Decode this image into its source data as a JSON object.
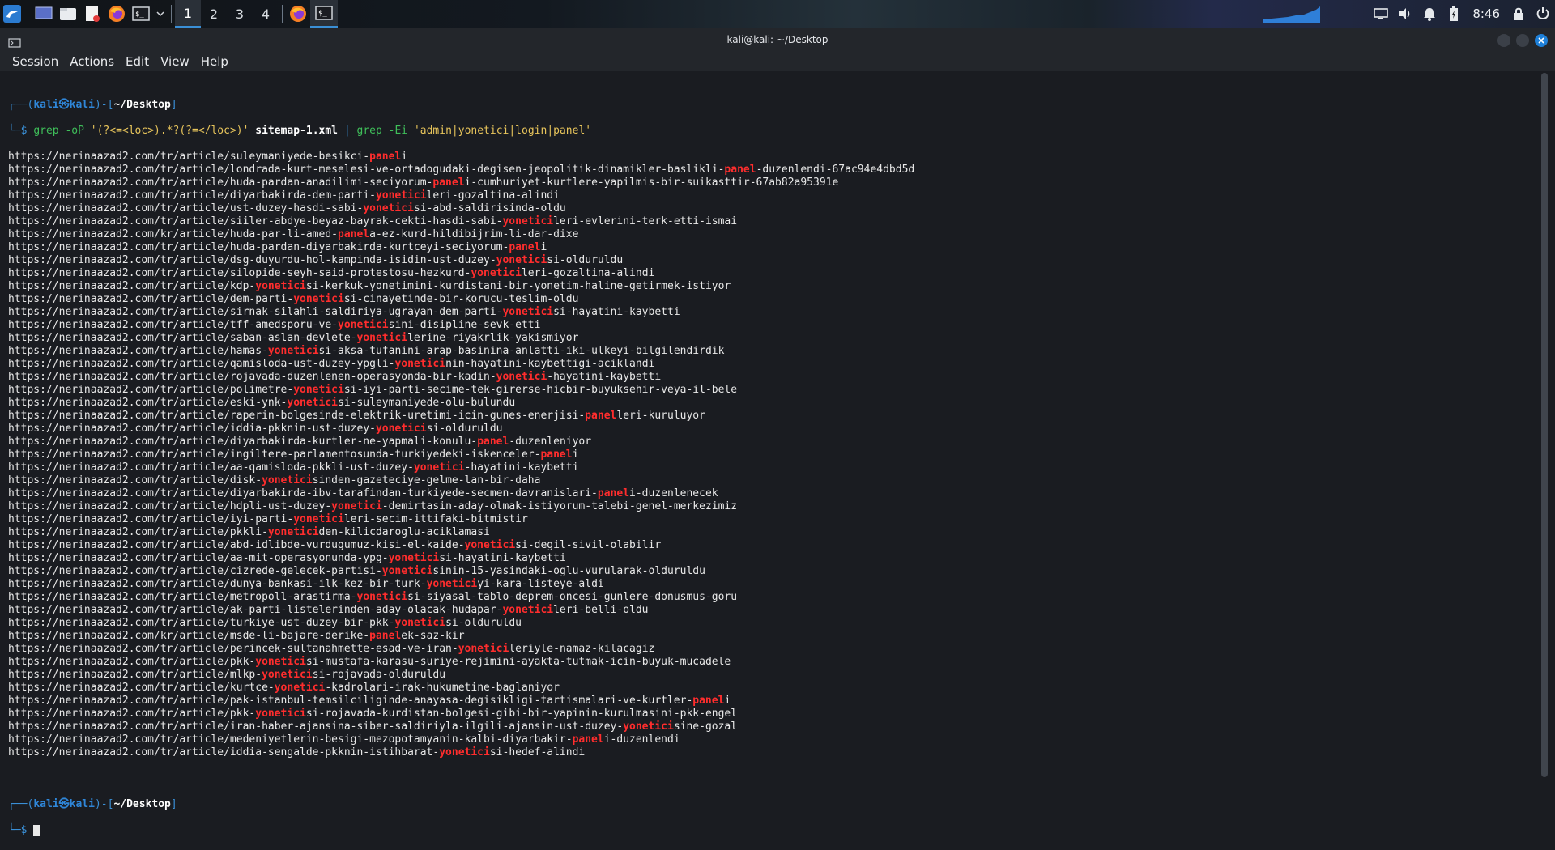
{
  "taskbar": {
    "workspaces": [
      "1",
      "2",
      "3",
      "4"
    ],
    "active_workspace": "1",
    "clock": "8:46",
    "icons": [
      "kali-menu-icon",
      "desktop-icon",
      "files-icon",
      "text-editor-icon",
      "firefox-icon",
      "terminal-icon",
      "chevron-down-icon"
    ]
  },
  "window": {
    "title": "kali@kali: ~/Desktop"
  },
  "menu": {
    "items": [
      "Session",
      "Actions",
      "Edit",
      "View",
      "Help"
    ]
  },
  "terminal": {
    "prompt_user": "kali",
    "prompt_host": "kali",
    "prompt_dir": "~/Desktop",
    "command": {
      "grep1": "grep",
      "flags1": " -oP ",
      "pattern1": "'(?<=<loc>).*?(?=</loc>)'",
      "file": " sitemap-1.xml ",
      "pipe": "|",
      "grep2": " grep",
      "flags2": " -Ei ",
      "pattern2": "'admin|yonetici|login|panel'"
    },
    "output": [
      [
        "https://nerinaazad2.com/tr/article/suleymaniyede-besikci-",
        "panel",
        "i"
      ],
      [
        "https://nerinaazad2.com/tr/article/londrada-kurt-meselesi-ve-ortadogudaki-degisen-jeopolitik-dinamikler-baslikli-",
        "panel",
        "-duzenlendi-67ac94e4dbd5d"
      ],
      [
        "https://nerinaazad2.com/tr/article/huda-pardan-anadilimi-seciyorum-",
        "panel",
        "i-cumhuriyet-kurtlere-yapilmis-bir-suikasttir-67ab82a95391e"
      ],
      [
        "https://nerinaazad2.com/tr/article/diyarbakirda-dem-parti-",
        "yonetici",
        "leri-gozaltina-alindi"
      ],
      [
        "https://nerinaazad2.com/tr/article/ust-duzey-hasdi-sabi-",
        "yonetici",
        "si-abd-saldirisinda-oldu"
      ],
      [
        "https://nerinaazad2.com/tr/article/siiler-abdye-beyaz-bayrak-cekti-hasdi-sabi-",
        "yonetici",
        "leri-evlerini-terk-etti-ismai"
      ],
      [
        "https://nerinaazad2.com/kr/article/huda-par-li-amed-",
        "panel",
        "a-ez-kurd-hildibijrim-li-dar-dixe"
      ],
      [
        "https://nerinaazad2.com/tr/article/huda-pardan-diyarbakirda-kurtceyi-seciyorum-",
        "panel",
        "i"
      ],
      [
        "https://nerinaazad2.com/tr/article/dsg-duyurdu-hol-kampinda-isidin-ust-duzey-",
        "yonetici",
        "si-olduruldu"
      ],
      [
        "https://nerinaazad2.com/tr/article/silopide-seyh-said-protestosu-hezkurd-",
        "yonetici",
        "leri-gozaltina-alindi"
      ],
      [
        "https://nerinaazad2.com/tr/article/kdp-",
        "yonetici",
        "si-kerkuk-yonetimini-kurdistani-bir-yonetim-haline-getirmek-istiyor"
      ],
      [
        "https://nerinaazad2.com/tr/article/dem-parti-",
        "yonetici",
        "si-cinayetinde-bir-korucu-teslim-oldu"
      ],
      [
        "https://nerinaazad2.com/tr/article/sirnak-silahli-saldiriya-ugrayan-dem-parti-",
        "yonetici",
        "si-hayatini-kaybetti"
      ],
      [
        "https://nerinaazad2.com/tr/article/tff-amedsporu-ve-",
        "yonetici",
        "sini-disipline-sevk-etti"
      ],
      [
        "https://nerinaazad2.com/tr/article/saban-aslan-devlete-",
        "yonetici",
        "lerine-riyakrlik-yakismiyor"
      ],
      [
        "https://nerinaazad2.com/tr/article/hamas-",
        "yonetici",
        "si-aksa-tufanini-arap-basinina-anlatti-iki-ulkeyi-bilgilendirdik"
      ],
      [
        "https://nerinaazad2.com/tr/article/qamisloda-ust-duzey-ypgli-",
        "yonetici",
        "nin-hayatini-kaybettigi-aciklandi"
      ],
      [
        "https://nerinaazad2.com/tr/article/rojavada-duzenlenen-operasyonda-bir-kadin-",
        "yonetici",
        "-hayatini-kaybetti"
      ],
      [
        "https://nerinaazad2.com/tr/article/polimetre-",
        "yonetici",
        "si-iyi-parti-secime-tek-girerse-hicbir-buyuksehir-veya-il-bele"
      ],
      [
        "https://nerinaazad2.com/tr/article/eski-ynk-",
        "yonetici",
        "si-suleymaniyede-olu-bulundu"
      ],
      [
        "https://nerinaazad2.com/tr/article/raperin-bolgesinde-elektrik-uretimi-icin-gunes-enerjisi-",
        "panel",
        "leri-kuruluyor"
      ],
      [
        "https://nerinaazad2.com/tr/article/iddia-pkknin-ust-duzey-",
        "yonetici",
        "si-olduruldu"
      ],
      [
        "https://nerinaazad2.com/tr/article/diyarbakirda-kurtler-ne-yapmali-konulu-",
        "panel",
        "-duzenleniyor"
      ],
      [
        "https://nerinaazad2.com/tr/article/ingiltere-parlamentosunda-turkiyedeki-iskenceler-",
        "panel",
        "i"
      ],
      [
        "https://nerinaazad2.com/tr/article/aa-qamisloda-pkkli-ust-duzey-",
        "yonetici",
        "-hayatini-kaybetti"
      ],
      [
        "https://nerinaazad2.com/tr/article/disk-",
        "yonetici",
        "sinden-gazeteciye-gelme-lan-bir-daha"
      ],
      [
        "https://nerinaazad2.com/tr/article/diyarbakirda-ibv-tarafindan-turkiyede-secmen-davranislari-",
        "panel",
        "i-duzenlenecek"
      ],
      [
        "https://nerinaazad2.com/tr/article/hdpli-ust-duzey-",
        "yonetici",
        "-demirtasin-aday-olmak-istiyorum-talebi-genel-merkezimiz"
      ],
      [
        "https://nerinaazad2.com/tr/article/iyi-parti-",
        "yonetici",
        "leri-secim-ittifaki-bitmistir"
      ],
      [
        "https://nerinaazad2.com/tr/article/pkkli-",
        "yonetici",
        "den-kilicdaroglu-aciklamasi"
      ],
      [
        "https://nerinaazad2.com/tr/article/abd-idlibde-vurdugumuz-kisi-el-kaide-",
        "yonetici",
        "si-degil-sivil-olabilir"
      ],
      [
        "https://nerinaazad2.com/tr/article/aa-mit-operasyonunda-ypg-",
        "yonetici",
        "si-hayatini-kaybetti"
      ],
      [
        "https://nerinaazad2.com/tr/article/cizrede-gelecek-partisi-",
        "yonetici",
        "sinin-15-yasindaki-oglu-vurularak-olduruldu"
      ],
      [
        "https://nerinaazad2.com/tr/article/dunya-bankasi-ilk-kez-bir-turk-",
        "yonetici",
        "yi-kara-listeye-aldi"
      ],
      [
        "https://nerinaazad2.com/tr/article/metropoll-arastirma-",
        "yonetici",
        "si-siyasal-tablo-deprem-oncesi-gunlere-donusmus-goru"
      ],
      [
        "https://nerinaazad2.com/tr/article/ak-parti-listelerinden-aday-olacak-hudapar-",
        "yonetici",
        "leri-belli-oldu"
      ],
      [
        "https://nerinaazad2.com/tr/article/turkiye-ust-duzey-bir-pkk-",
        "yonetici",
        "si-olduruldu"
      ],
      [
        "https://nerinaazad2.com/kr/article/msde-li-bajare-derike-",
        "panel",
        "ek-saz-kir"
      ],
      [
        "https://nerinaazad2.com/tr/article/perincek-sultanahmette-esad-ve-iran-",
        "yonetici",
        "leriyle-namaz-kilacagiz"
      ],
      [
        "https://nerinaazad2.com/tr/article/pkk-",
        "yonetici",
        "si-mustafa-karasu-suriye-rejimini-ayakta-tutmak-icin-buyuk-mucadele"
      ],
      [
        "https://nerinaazad2.com/tr/article/mlkp-",
        "yonetici",
        "si-rojavada-olduruldu"
      ],
      [
        "https://nerinaazad2.com/tr/article/kurtce-",
        "yonetici",
        "-kadrolari-irak-hukumetine-baglaniyor"
      ],
      [
        "https://nerinaazad2.com/tr/article/pak-istanbul-temsilciliginde-anayasa-degisikligi-tartismalari-ve-kurtler-",
        "panel",
        "i"
      ],
      [
        "https://nerinaazad2.com/tr/article/pkk-",
        "yonetici",
        "si-rojavada-kurdistan-bolgesi-gibi-bir-yapinin-kurulmasini-pkk-engel"
      ],
      [
        "https://nerinaazad2.com/tr/article/iran-haber-ajansina-siber-saldiriyla-ilgili-ajansin-ust-duzey-",
        "yonetici",
        "sine-gozal"
      ],
      [
        "https://nerinaazad2.com/tr/article/medeniyetlerin-besigi-mezopotamyanin-kalbi-diyarbakir-",
        "panel",
        "i-duzenlendi"
      ],
      [
        "https://nerinaazad2.com/tr/article/iddia-sengalde-pkknin-istihbarat-",
        "yonetici",
        "si-hedef-alindi"
      ]
    ]
  },
  "colors": {
    "prompt": "#2f86d8",
    "match": "#ff2d2d",
    "command": "#3fbf5a",
    "string": "#e7c45b"
  }
}
